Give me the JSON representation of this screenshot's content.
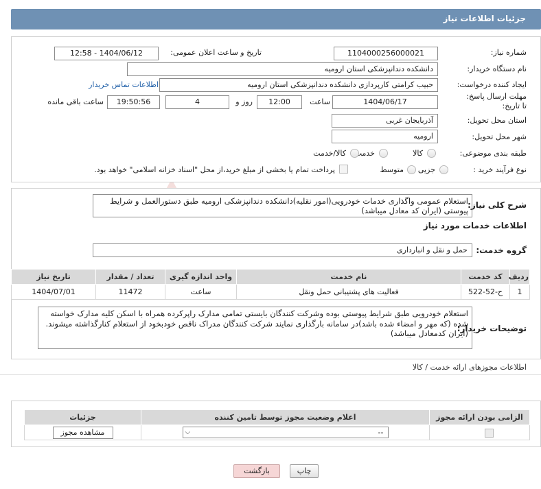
{
  "header": {
    "title": "جزئیات اطلاعات نیاز"
  },
  "form": {
    "need_number_label": "شماره نیاز:",
    "need_number": "1104000256000021",
    "announce_label": "تاریخ و ساعت اعلان عمومی:",
    "announce_value": "1404/06/12 - 12:58",
    "buyer_org_label": "نام دستگاه خریدار:",
    "buyer_org": "دانشکده دندانپزشکی استان ارومیه",
    "requester_label": "ایجاد کننده درخواست:",
    "requester": "حبیب کرامتی کارپردازی دانشکده دندانپزشکی استان ارومیه",
    "contact_link": "اطلاعات تماس خریدار",
    "deadline_label": "مهلت ارسال پاسخ: تا تاریخ:",
    "deadline_date": "1404/06/17",
    "time_label": "ساعت",
    "deadline_time": "12:00",
    "days_value": "4",
    "days_label": "روز و",
    "remaining_time": "19:50:56",
    "remaining_label": "ساعت باقی مانده",
    "province_label": "استان محل تحویل:",
    "province": "آذربایجان غربی",
    "city_label": "شهر محل تحویل:",
    "city": "ارومیه",
    "category_label": "طبقه بندی موضوعی:",
    "category_options": [
      "کالا",
      "خدمت",
      "کالا/خدمت"
    ],
    "purchase_type_label": "نوع فرآیند خرید :",
    "purchase_options": [
      "جزیی",
      "متوسط"
    ],
    "payment_note": "پرداخت تمام یا بخشی از مبلغ خرید،از محل \"اسناد خزانه اسلامی\" خواهد بود."
  },
  "summary": {
    "label": "شرح کلی نیاز:",
    "text": "استعلام عمومی واگذاری خدمات خودرویی(امور نقلیه)دانشکده دندانپزشکی ارومیه طبق دستورالعمل و شرایط پیوستی (ایران کد معادل میباشد)"
  },
  "services": {
    "section_title": "اطلاعات خدمات مورد نیاز",
    "group_label": "گروه خدمت:",
    "group_value": "حمل و نقل و انبارداری",
    "columns": [
      "ردیف",
      "کد خدمت",
      "نام خدمت",
      "واحد اندازه گیری",
      "تعداد / مقدار",
      "تاریخ نیاز"
    ],
    "rows": [
      [
        "1",
        "ح-52-522",
        "فعالیت های پشتیبانی حمل ونقل",
        "ساعت",
        "11472",
        "1404/07/01"
      ]
    ]
  },
  "buyer_notes": {
    "label": "توضیحات خریدار:",
    "text": "استعلام خودرویی طبق شرایط پیوستی بوده وشرکت کنندگان بایستی تمامی مدارک راپرکرده همراه با اسکن کلیه مدارک خواسته شده (که مهر و امضاء شده باشد)در سامانه بارگذاری نمایند شرکت کنندگان مدراک ناقص خودبخود از استعلام کنارگذاشته میشوند.(ایران کدمعادل میباشد)"
  },
  "permits": {
    "section_title": "اطلاعات مجوزهای ارائه خدمت / کالا",
    "columns": [
      "الزامی بودن ارائه مجوز",
      "اعلام وضعیت مجوز توسط تامین کننده",
      "جزئیات"
    ],
    "select_value": "--",
    "view_button": "مشاهده مجوز"
  },
  "footer": {
    "print_button": "چاپ",
    "back_button": "بازگشت"
  },
  "watermark": {
    "text": "AriaTender.neT"
  },
  "colors": {
    "header_bg": "#6f91b4",
    "link": "#1f5fa8",
    "back_button_bg": "#f6d6d6"
  }
}
